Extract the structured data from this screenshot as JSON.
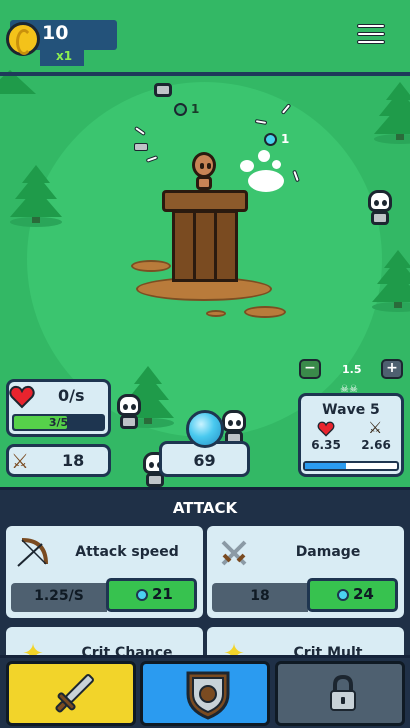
{
  "header": {
    "coins": "10",
    "coin_multiplier": "x1",
    "menu_icon": "hamburger-menu-icon"
  },
  "game": {
    "gem_drop_1": "1",
    "gem_drop_2": "1",
    "speed": "1.5",
    "speed_decrease_label": "−",
    "speed_increase_label": "+",
    "health": {
      "regen": "0/s",
      "current_max": "3/5",
      "fraction": 0.6
    },
    "damage": "18",
    "gems": "69",
    "wave": {
      "title": "Wave 5",
      "enemy_health": "6.35",
      "enemy_damage": "2.66",
      "progress": 0.45
    },
    "colors": {
      "grass": "#33b865",
      "arena": "#3bc56f",
      "health_bar": "#56d14a",
      "wave_bar": "#2b9bf0"
    }
  },
  "panel": {
    "title": "ATTACK",
    "upgrades": [
      {
        "title": "Attack speed",
        "value": "1.25/S",
        "cost": "21",
        "icon": "bow-icon"
      },
      {
        "title": "Damage",
        "value": "18",
        "cost": "24",
        "icon": "crossed-swords-icon"
      },
      {
        "title": "Crit Chance",
        "icon": "crit-chance-icon"
      },
      {
        "title": "Crit Mult",
        "icon": "crit-mult-icon"
      }
    ],
    "buy_color": "#37c24f"
  },
  "nav": {
    "tabs": [
      {
        "icon": "sword-icon",
        "color": "#f2d42a"
      },
      {
        "icon": "shield-icon",
        "color": "#2b9bf0"
      },
      {
        "icon": "lock-icon",
        "color": "#4e6070"
      }
    ]
  }
}
